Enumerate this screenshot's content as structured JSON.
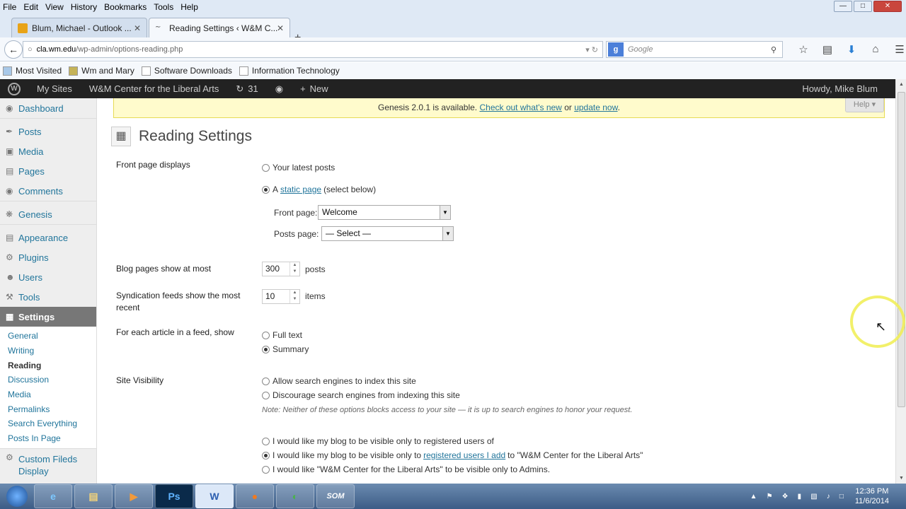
{
  "menubar": [
    "File",
    "Edit",
    "View",
    "History",
    "Bookmarks",
    "Tools",
    "Help"
  ],
  "tabs": [
    {
      "label": "Blum, Michael - Outlook ...",
      "fav_color": "#e8a317"
    },
    {
      "label": "Reading Settings ‹ W&M C...",
      "fav_color": "#f5f8fc"
    }
  ],
  "url": {
    "host": "cla.wm.edu",
    "path": "/wp-admin/options-reading.php"
  },
  "search": {
    "placeholder": "Google"
  },
  "bookmarks": [
    "Most Visited",
    "Wm and Mary",
    "Software Downloads",
    "Information Technology"
  ],
  "adminbar": {
    "my_sites": "My Sites",
    "site_name": "W&M Center for the Liberal Arts",
    "updates": "31",
    "new": "New",
    "howdy": "Howdy, Mike Blum"
  },
  "sidebar": {
    "items": [
      "Dashboard",
      "Posts",
      "Media",
      "Pages",
      "Comments",
      "Genesis",
      "Appearance",
      "Plugins",
      "Users",
      "Tools",
      "Settings"
    ],
    "submenu": [
      "General",
      "Writing",
      "Reading",
      "Discussion",
      "Media",
      "Permalinks",
      "Search Everything",
      "Posts In Page"
    ],
    "extra": "Custom Fileds Display"
  },
  "notice": {
    "text": "Genesis 2.0.1 is available.",
    "link1": "Check out what's new",
    "or": "or",
    "link2": "update now",
    "end": "."
  },
  "help": "Help",
  "title": "Reading Settings",
  "front_page": {
    "label": "Front page displays",
    "opt_latest": "Your latest posts",
    "opt_static_a": "A",
    "opt_static_link": "static page",
    "opt_static_rest": "(select below)",
    "front_label": "Front page:",
    "front_value": "Welcome",
    "posts_label": "Posts page:",
    "posts_value": "— Select —"
  },
  "blog_pages": {
    "label": "Blog pages show at most",
    "value": "300",
    "unit": "posts"
  },
  "syndication": {
    "label": "Syndication feeds show the most recent",
    "value": "10",
    "unit": "items"
  },
  "feed_article": {
    "label": "For each article in a feed, show",
    "full": "Full text",
    "summary": "Summary"
  },
  "visibility": {
    "label": "Site Visibility",
    "allow": "Allow search engines to index this site",
    "discourage": "Discourage search engines from indexing this site",
    "note": "Note: Neither of these options blocks access to your site — it is up to search engines to honor your request.",
    "reg_users": "I would like my blog to be visible only to registered users of",
    "reg_add_a": "I would like my blog to be visible only to",
    "reg_add_link": "registered users I add",
    "reg_add_b": "to \"W&M Center for the Liberal Arts\"",
    "admins": "I would like \"W&M Center for the Liberal Arts\" to be visible only to Admins."
  },
  "taskbar": {
    "apps": [
      "e",
      "▤",
      "▶",
      "Ps",
      "W",
      "●",
      "◐",
      "SOM"
    ],
    "time": "12:36 PM",
    "date": "11/6/2014"
  }
}
